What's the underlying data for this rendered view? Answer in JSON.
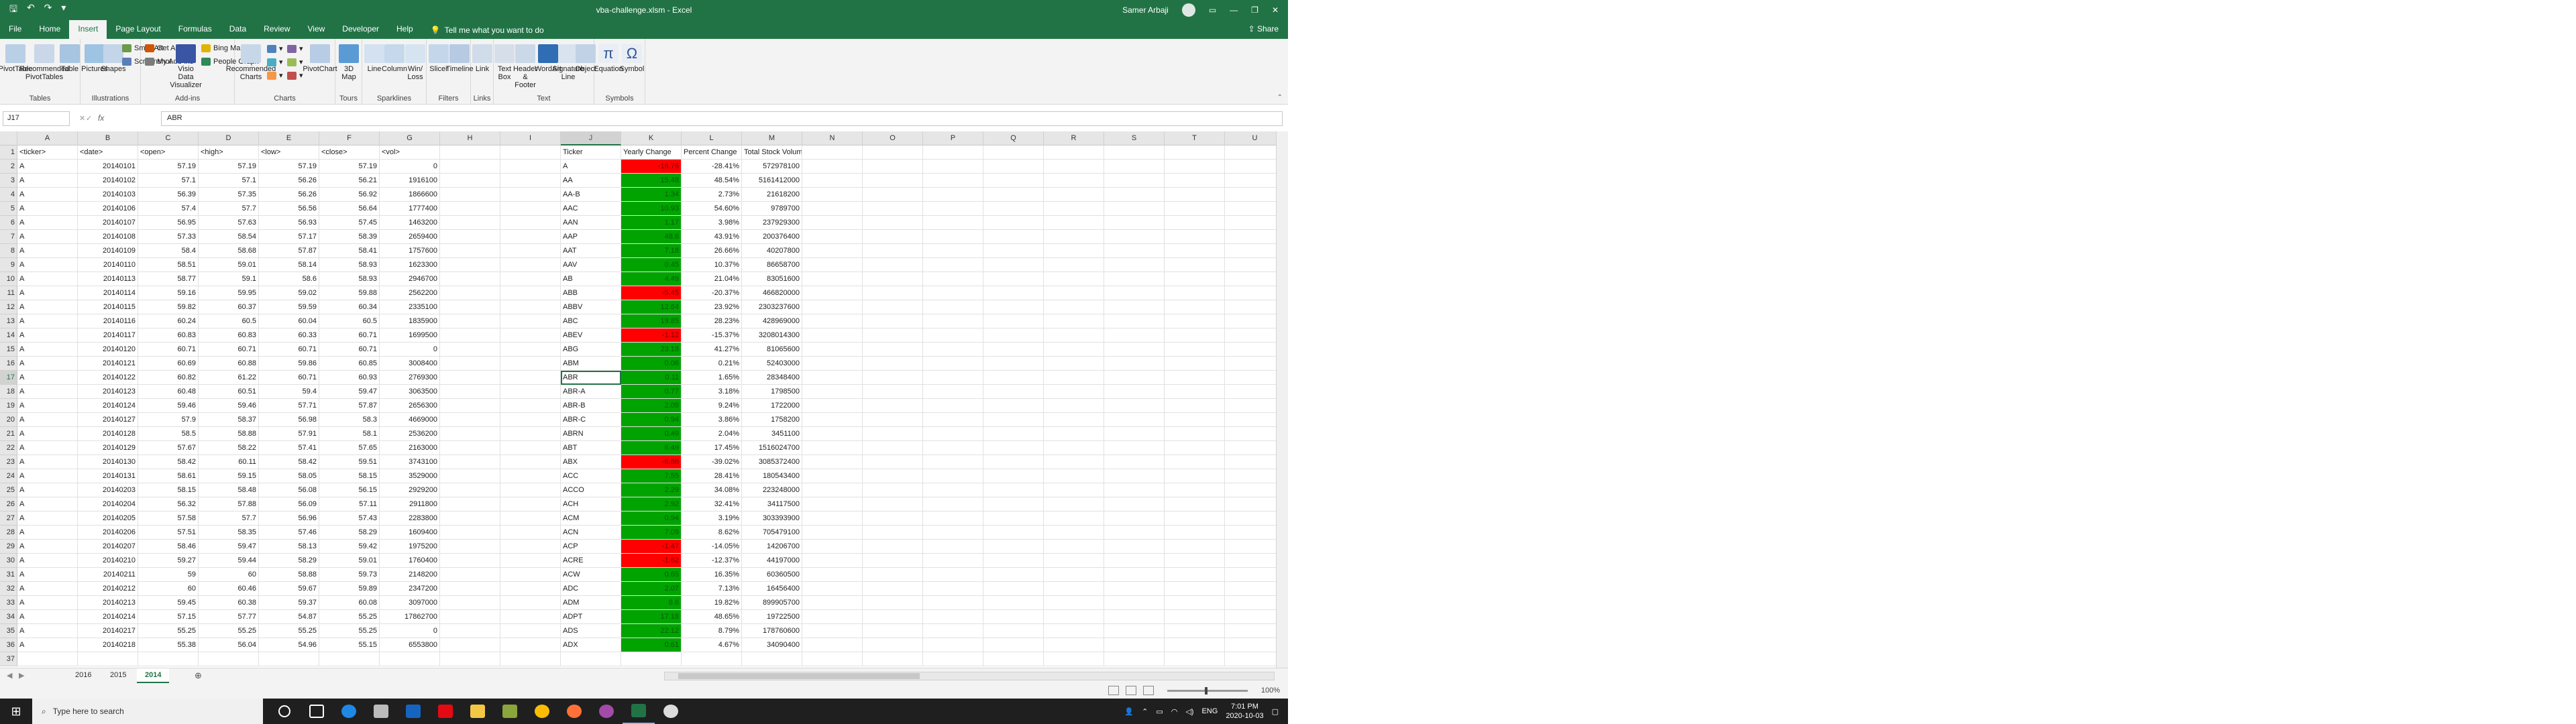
{
  "window": {
    "title": "vba-challenge.xlsm  -  Excel",
    "user": "Samer Arbaji"
  },
  "tabs": [
    "File",
    "Home",
    "Insert",
    "Page Layout",
    "Formulas",
    "Data",
    "Review",
    "View",
    "Developer",
    "Help"
  ],
  "active_tab": "Insert",
  "tellme": "Tell me what you want to do",
  "share": "Share",
  "ribbon": {
    "groups": [
      {
        "label": "Tables",
        "buttons": [
          "PivotTable",
          "Recommended PivotTables",
          "Table"
        ]
      },
      {
        "label": "Illustrations",
        "buttons": [
          "Pictures",
          "Shapes"
        ],
        "small": [
          "SmartArt",
          "Screenshot"
        ]
      },
      {
        "label": "Add-ins",
        "small": [
          "Get Add-ins",
          "My Add-ins"
        ],
        "buttons": [
          "Visio Data Visualizer"
        ],
        "small2": [
          "Bing Maps",
          "People Graph"
        ]
      },
      {
        "label": "Charts",
        "buttons": [
          "Recommended Charts",
          "PivotChart"
        ]
      },
      {
        "label": "Tours",
        "buttons": [
          "3D Map"
        ]
      },
      {
        "label": "Sparklines",
        "buttons": [
          "Line",
          "Column",
          "Win/ Loss"
        ]
      },
      {
        "label": "Filters",
        "buttons": [
          "Slicer",
          "Timeline"
        ]
      },
      {
        "label": "Links",
        "buttons": [
          "Link"
        ]
      },
      {
        "label": "Text",
        "buttons": [
          "Text Box",
          "Header & Footer",
          "WordArt",
          "Signature Line",
          "Object"
        ]
      },
      {
        "label": "Symbols",
        "buttons": [
          "Equation",
          "Symbol"
        ]
      }
    ]
  },
  "formula_bar": {
    "name_box": "J17",
    "fx": "fx",
    "value": "ABR"
  },
  "columns": [
    "A",
    "B",
    "C",
    "D",
    "E",
    "F",
    "G",
    "H",
    "I",
    "J",
    "K",
    "L",
    "M",
    "N",
    "O",
    "P",
    "Q",
    "R",
    "S",
    "T",
    "U"
  ],
  "headers_row": [
    "<ticker>",
    "<date>",
    "<open>",
    "<high>",
    "<low>",
    "<close>",
    "<vol>"
  ],
  "summary_headers": [
    "Ticker",
    "Yearly Change",
    "Percent Change",
    "Total Stock Volume"
  ],
  "rows": [
    [
      "A",
      "20140101",
      "57.19",
      "57.19",
      "57.19",
      "57.19",
      "0"
    ],
    [
      "A",
      "20140102",
      "57.1",
      "57.1",
      "56.26",
      "56.21",
      "1916100"
    ],
    [
      "A",
      "20140103",
      "56.39",
      "57.35",
      "56.26",
      "56.92",
      "1866600"
    ],
    [
      "A",
      "20140106",
      "57.4",
      "57.7",
      "56.56",
      "56.64",
      "1777400"
    ],
    [
      "A",
      "20140107",
      "56.95",
      "57.63",
      "56.93",
      "57.45",
      "1463200"
    ],
    [
      "A",
      "20140108",
      "57.33",
      "58.54",
      "57.17",
      "58.39",
      "2659400"
    ],
    [
      "A",
      "20140109",
      "58.4",
      "58.68",
      "57.87",
      "58.41",
      "1757600"
    ],
    [
      "A",
      "20140110",
      "58.51",
      "59.01",
      "58.14",
      "58.93",
      "1623300"
    ],
    [
      "A",
      "20140113",
      "58.77",
      "59.1",
      "58.6",
      "58.93",
      "2946700"
    ],
    [
      "A",
      "20140114",
      "59.16",
      "59.95",
      "59.02",
      "59.88",
      "2562200"
    ],
    [
      "A",
      "20140115",
      "59.82",
      "60.37",
      "59.59",
      "60.34",
      "2335100"
    ],
    [
      "A",
      "20140116",
      "60.24",
      "60.5",
      "60.04",
      "60.5",
      "1835900"
    ],
    [
      "A",
      "20140117",
      "60.83",
      "60.83",
      "60.33",
      "60.71",
      "1699500"
    ],
    [
      "A",
      "20140120",
      "60.71",
      "60.71",
      "60.71",
      "60.71",
      "0"
    ],
    [
      "A",
      "20140121",
      "60.69",
      "60.88",
      "59.86",
      "60.85",
      "3008400"
    ],
    [
      "A",
      "20140122",
      "60.82",
      "61.22",
      "60.71",
      "60.93",
      "2769300"
    ],
    [
      "A",
      "20140123",
      "60.48",
      "60.51",
      "59.4",
      "59.47",
      "3063500"
    ],
    [
      "A",
      "20140124",
      "59.46",
      "59.46",
      "57.71",
      "57.87",
      "2656300"
    ],
    [
      "A",
      "20140127",
      "57.9",
      "58.37",
      "56.98",
      "58.3",
      "4669000"
    ],
    [
      "A",
      "20140128",
      "58.5",
      "58.88",
      "57.91",
      "58.1",
      "2536200"
    ],
    [
      "A",
      "20140129",
      "57.67",
      "58.22",
      "57.41",
      "57.65",
      "2163000"
    ],
    [
      "A",
      "20140130",
      "58.42",
      "60.11",
      "58.42",
      "59.51",
      "3743100"
    ],
    [
      "A",
      "20140131",
      "58.61",
      "59.15",
      "58.05",
      "58.15",
      "3529000"
    ],
    [
      "A",
      "20140203",
      "58.15",
      "58.48",
      "56.08",
      "56.15",
      "2929200"
    ],
    [
      "A",
      "20140204",
      "56.32",
      "57.88",
      "56.09",
      "57.11",
      "2911800"
    ],
    [
      "A",
      "20140205",
      "57.58",
      "57.7",
      "56.96",
      "57.43",
      "2283800"
    ],
    [
      "A",
      "20140206",
      "57.51",
      "58.35",
      "57.46",
      "58.29",
      "1609400"
    ],
    [
      "A",
      "20140207",
      "58.46",
      "59.47",
      "58.13",
      "59.42",
      "1975200"
    ],
    [
      "A",
      "20140210",
      "59.27",
      "59.44",
      "58.29",
      "59.01",
      "1760400"
    ],
    [
      "A",
      "20140211",
      "59",
      "60",
      "58.88",
      "59.73",
      "2148200"
    ],
    [
      "A",
      "20140212",
      "60",
      "60.46",
      "59.67",
      "59.89",
      "2347200"
    ],
    [
      "A",
      "20140213",
      "59.45",
      "60.38",
      "59.37",
      "60.08",
      "3097000"
    ],
    [
      "A",
      "20140214",
      "57.15",
      "57.77",
      "54.87",
      "55.25",
      "17862700"
    ],
    [
      "A",
      "20140217",
      "55.25",
      "55.25",
      "55.25",
      "55.25",
      "0"
    ],
    [
      "A",
      "20140218",
      "55.38",
      "56.04",
      "54.96",
      "55.15",
      "6553800"
    ]
  ],
  "summary": [
    [
      "A",
      "-16.76",
      "-28.41%",
      "572978100",
      "red"
    ],
    [
      "AA",
      "15.48",
      "48.54%",
      "5161412000",
      "grn"
    ],
    [
      "AA-B",
      "1.34",
      "2.73%",
      "21618200",
      "grn"
    ],
    [
      "AAC",
      "10.93",
      "54.60%",
      "9789700",
      "grn"
    ],
    [
      "AAN",
      "1.17",
      "3.98%",
      "237929300",
      "grn"
    ],
    [
      "AAP",
      "48.6",
      "43.91%",
      "200376400",
      "grn"
    ],
    [
      "AAT",
      "7.18",
      "26.66%",
      "40207800",
      "grn"
    ],
    [
      "AAV",
      "0.45",
      "10.37%",
      "86658700",
      "grn"
    ],
    [
      "AB",
      "4.49",
      "21.04%",
      "83051600",
      "grn"
    ],
    [
      "ABB",
      "-5.45",
      "-20.37%",
      "466820000",
      "red"
    ],
    [
      "ABBV",
      "12.64",
      "23.92%",
      "2303237600",
      "grn"
    ],
    [
      "ABC",
      "19.85",
      "28.23%",
      "428969000",
      "grn"
    ],
    [
      "ABEV",
      "-1.12",
      "-15.37%",
      "3208014300",
      "red"
    ],
    [
      "ABG",
      "23.18",
      "41.27%",
      "81065600",
      "grn"
    ],
    [
      "ABM",
      "0.06",
      "0.21%",
      "52403000",
      "grn"
    ],
    [
      "ABR",
      "0.11",
      "1.65%",
      "28348400",
      "grn"
    ],
    [
      "ABR-A",
      "0.77",
      "3.18%",
      "1798500",
      "grn"
    ],
    [
      "ABR-B",
      "2.09",
      "9.24%",
      "1722000",
      "grn"
    ],
    [
      "ABR-C",
      "0.94",
      "3.86%",
      "1758200",
      "grn"
    ],
    [
      "ABRN",
      "0.49",
      "2.04%",
      "3451100",
      "grn"
    ],
    [
      "ABT",
      "6.49",
      "17.45%",
      "1516024700",
      "grn"
    ],
    [
      "ABX",
      "-6.88",
      "-39.02%",
      "3085372400",
      "red"
    ],
    [
      "ACC",
      "7.55",
      "28.41%",
      "180543400",
      "grn"
    ],
    [
      "ACCO",
      "2.29",
      "34.08%",
      "223248000",
      "grn"
    ],
    [
      "ACH",
      "2.92",
      "32.41%",
      "34117500",
      "grn"
    ],
    [
      "ACM",
      "0.94",
      "3.19%",
      "303393900",
      "grn"
    ],
    [
      "ACN",
      "7.09",
      "8.62%",
      "705479100",
      "grn"
    ],
    [
      "ACP",
      "-1.47",
      "-14.05%",
      "14206700",
      "red"
    ],
    [
      "ACRE",
      "-1.62",
      "-12.37%",
      "44197000",
      "red"
    ],
    [
      "ACW",
      "0.65",
      "16.35%",
      "60360500",
      "grn"
    ],
    [
      "ADC",
      "2.07",
      "7.13%",
      "16456400",
      "grn"
    ],
    [
      "ADM",
      "8.6",
      "19.82%",
      "899905700",
      "grn"
    ],
    [
      "ADPT",
      "17.18",
      "48.65%",
      "19722500",
      "grn"
    ],
    [
      "ADS",
      "22.12",
      "8.79%",
      "178760600",
      "grn"
    ],
    [
      "ADX",
      "0.61",
      "4.67%",
      "34090400",
      "grn"
    ]
  ],
  "sheets": [
    "2016",
    "2015",
    "2014"
  ],
  "active_sheet": "2014",
  "status": {
    "zoom": "100%"
  },
  "taskbar": {
    "search": "Type here to search",
    "time": "7:01 PM",
    "date": "2020-10-03",
    "lang": "ENG"
  },
  "colors": {
    "excel_green": "#217346",
    "positive": "#00a300",
    "negative": "#ff0000"
  }
}
